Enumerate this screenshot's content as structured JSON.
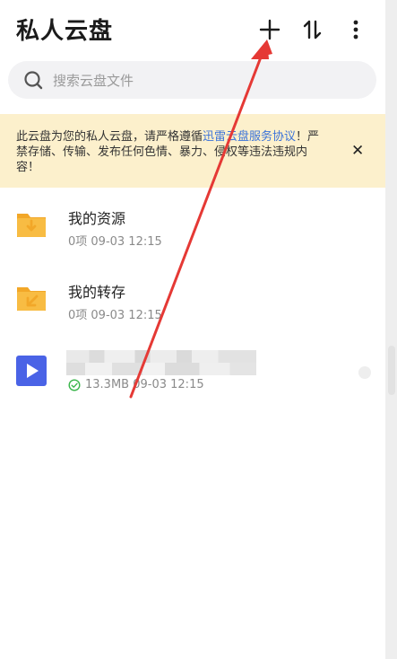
{
  "header": {
    "title": "私人云盘"
  },
  "search": {
    "placeholder": "搜索云盘文件"
  },
  "notice": {
    "text_before": "此云盘为您的私人云盘，请严格遵循",
    "link": "迅雷云盘服务协议",
    "text_after": "！严禁存储、传输、发布任何色情、暴力、侵权等违法违规内容！",
    "close_glyph": "✕"
  },
  "files": [
    {
      "name": "我的资源",
      "meta": "0项  09-03 12:15",
      "icon": "download-folder-icon"
    },
    {
      "name": "我的转存",
      "meta": "0项  09-03 12:15",
      "icon": "transfer-folder-icon"
    },
    {
      "name": "",
      "size": "13.3MB",
      "date": "09-03 12:15",
      "icon": "video-file-icon"
    }
  ],
  "colors": {
    "folder": "#f6b73c",
    "video": "#4a63e6",
    "notice_bg": "#fcf0cc",
    "link": "#3b73d9",
    "arrow": "#e53935"
  }
}
